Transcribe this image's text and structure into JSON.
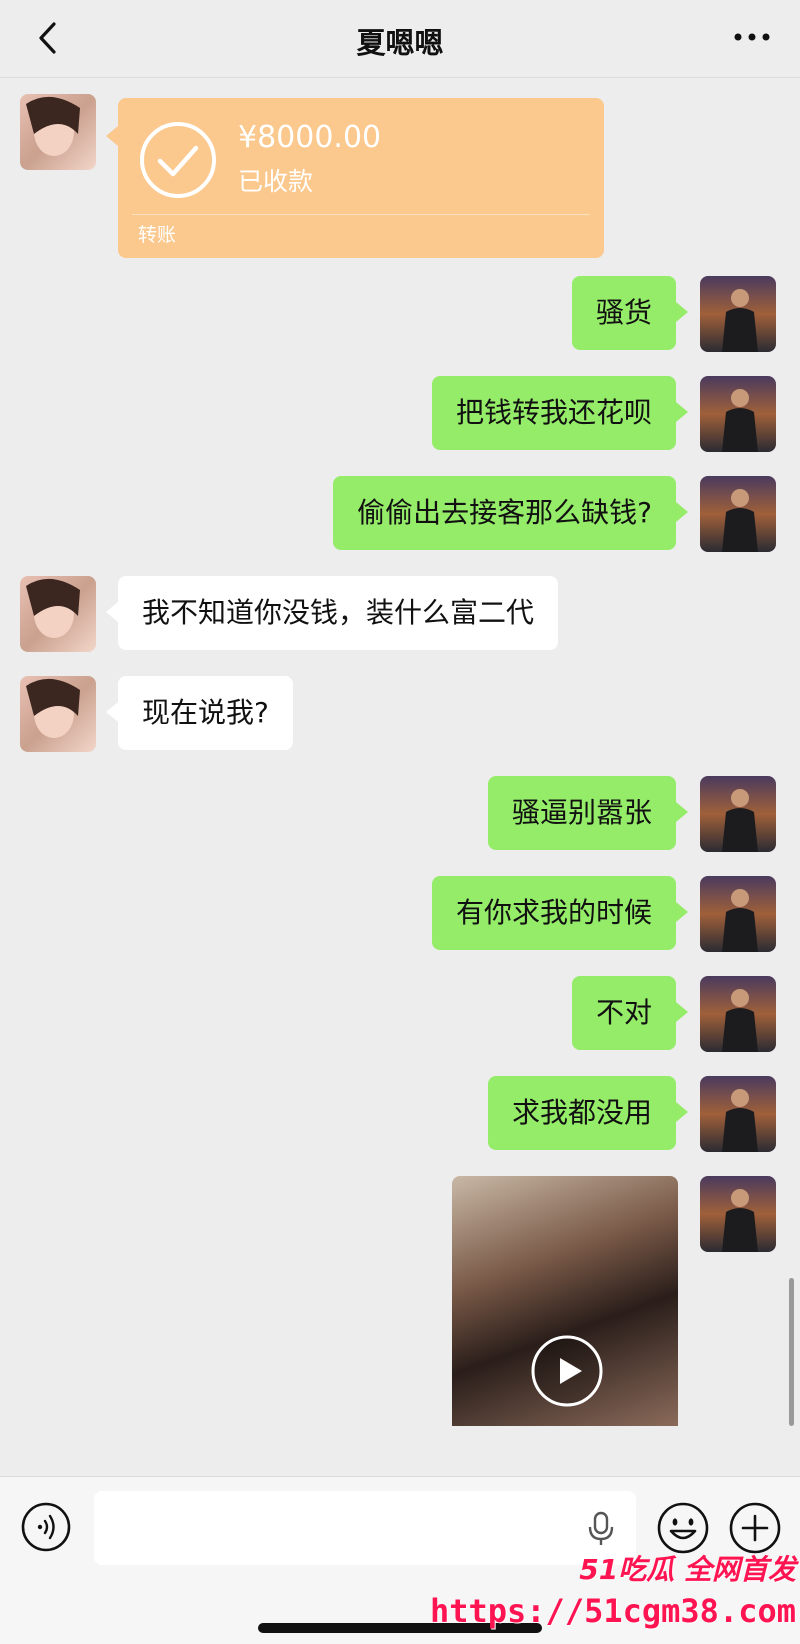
{
  "header": {
    "title": "夏嗯嗯",
    "back_icon": "chevron-left-icon",
    "more_icon": "more-dots-icon"
  },
  "transfer": {
    "amount": "¥8000.00",
    "status": "已收款",
    "label": "转账",
    "color": "#fbc88d"
  },
  "messages": [
    {
      "side": "right",
      "text": "骚货"
    },
    {
      "side": "right",
      "text": "把钱转我还花呗"
    },
    {
      "side": "right",
      "text": "偷偷出去接客那么缺钱?"
    },
    {
      "side": "left",
      "text": "我不知道你没钱，装什么富二代"
    },
    {
      "side": "left",
      "text": "现在说我?"
    },
    {
      "side": "right",
      "text": "骚逼别嚣张"
    },
    {
      "side": "right",
      "text": "有你求我的时候"
    },
    {
      "side": "right",
      "text": "不对"
    },
    {
      "side": "right",
      "text": "求我都没用"
    }
  ],
  "colors": {
    "outgoing_bubble": "#95ec69",
    "incoming_bubble": "#ffffff",
    "background": "#ededed",
    "watermark": "#ff1452"
  },
  "input_bar": {
    "placeholder": "",
    "voice_icon": "voice-icon",
    "mic_icon": "mic-icon",
    "emoji_icon": "emoji-icon",
    "plus_icon": "plus-icon"
  },
  "watermark": {
    "brand": "51吃瓜 全网首发",
    "url": "https://51cgm38.com"
  }
}
